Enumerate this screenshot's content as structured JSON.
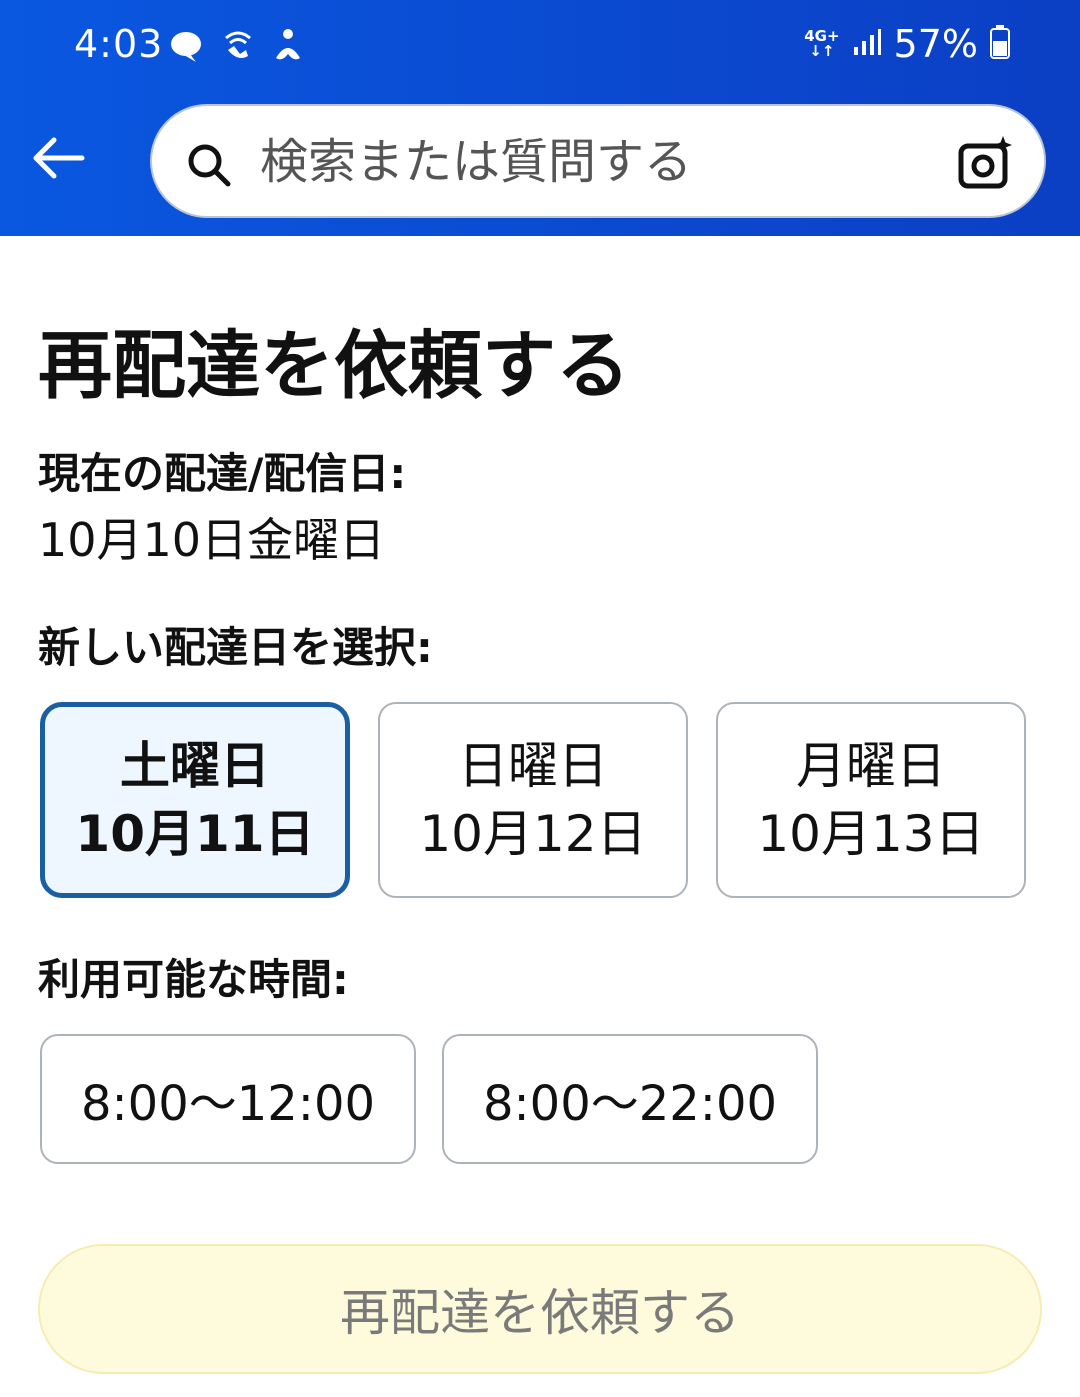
{
  "status_bar": {
    "time": "4:03",
    "network": "4G+",
    "battery": "57%"
  },
  "search": {
    "placeholder": "検索または質問する"
  },
  "page": {
    "title": "再配達を依頼する",
    "current_label": "現在の配達/配信日:",
    "current_date": "10月10日金曜日",
    "select_label": "新しい配達日を選択:",
    "dates": [
      {
        "dow": "土曜日",
        "date": "10月11日",
        "selected": true
      },
      {
        "dow": "日曜日",
        "date": "10月12日",
        "selected": false
      },
      {
        "dow": "月曜日",
        "date": "10月13日",
        "selected": false
      }
    ],
    "time_label": "利用可能な時間:",
    "times": [
      "8:00〜12:00",
      "8:00〜22:00"
    ],
    "submit_label": "再配達を依頼する"
  },
  "colors": {
    "header": "#0b4fd6",
    "selected_border": "#1b5fa3",
    "selected_bg": "#eef7ff",
    "submit_bg": "#fefbdc"
  },
  "icons": {
    "status_left": [
      "chat-bubble-icon",
      "wifi-calling-icon",
      "accessibility-icon"
    ],
    "status_right": [
      "signal-icon",
      "battery-icon"
    ],
    "header": [
      "back-arrow-icon",
      "search-icon",
      "camera-sparkle-icon"
    ]
  }
}
